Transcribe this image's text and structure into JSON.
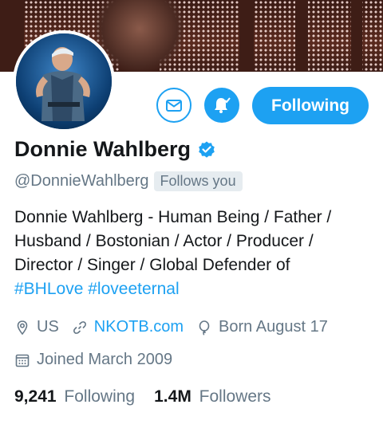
{
  "profile": {
    "display_name": "Donnie Wahlberg",
    "handle": "@DonnieWahlberg",
    "follows_you": "Follows you",
    "verified": true
  },
  "actions": {
    "message_icon": "envelope-icon",
    "notify_icon": "bell-plus-icon",
    "follow_label": "Following"
  },
  "bio": {
    "lines": [
      "Donnie Wahlberg - Human Being / Father /",
      "Husband / Bostonian / Actor / Producer /",
      "Director / Singer / Global Defender of"
    ],
    "hashtags": [
      "#BHLove",
      "#loveeternal"
    ]
  },
  "meta": {
    "location": "US",
    "website": "NKOTB.com",
    "birthday": "Born August 17",
    "joined": "Joined March 2009"
  },
  "stats": {
    "following_count": "9,241",
    "following_label": "Following",
    "followers_count": "1.4M",
    "followers_label": "Followers"
  },
  "colors": {
    "accent": "#1da1f2",
    "secondary_text": "#657786",
    "primary_text": "#14171a"
  }
}
